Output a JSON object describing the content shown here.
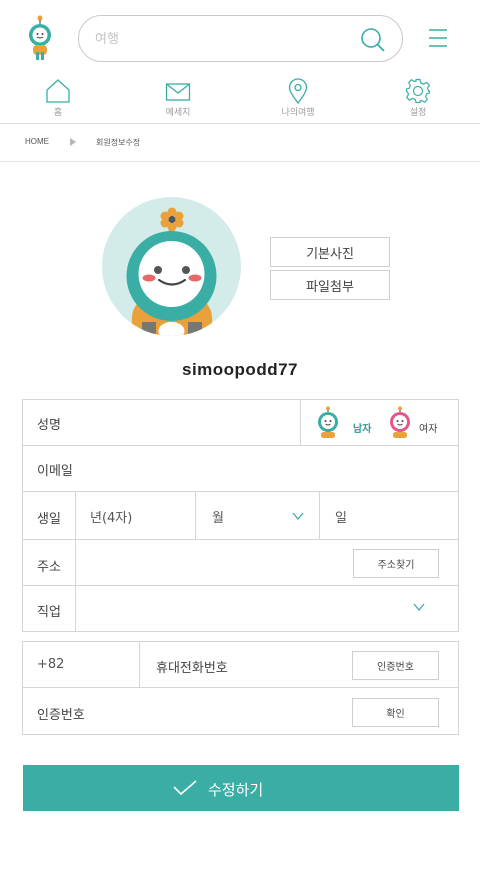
{
  "header": {
    "search_placeholder": "여행"
  },
  "nav": [
    {
      "label": "홈",
      "icon": "home-icon"
    },
    {
      "label": "메세지",
      "icon": "mail-icon"
    },
    {
      "label": "나의여행",
      "icon": "location-pin-icon"
    },
    {
      "label": "설정",
      "icon": "gear-icon"
    }
  ],
  "breadcrumb": {
    "home": "HOME",
    "current": "회원정보수정"
  },
  "profile": {
    "default_photo_label": "기본사진",
    "attach_file_label": "파일첨부",
    "username": "simoopodd77"
  },
  "form": {
    "name_label": "성명",
    "gender_male": "남자",
    "gender_female": "여자",
    "gender_selected": "남자",
    "email_label": "이메일",
    "birth_label": "생일",
    "year_placeholder": "년(4자)",
    "month_placeholder": "월",
    "day_placeholder": "일",
    "address_label": "주소",
    "address_search_button": "주소찾기",
    "job_label": "직업"
  },
  "phone": {
    "country_code": "+82",
    "phone_placeholder": "휴대전화번호",
    "request_code_button": "인증번호",
    "code_label": "인증번호",
    "confirm_button": "확인"
  },
  "submit_label": "수정하기",
  "colors": {
    "accent": "#3aaea5",
    "border": "#d5d5d5",
    "male_text": "#2a9d94",
    "avatar_bg": "#d3ecea",
    "mascot_orange": "#e9a13b",
    "mascot_pink": "#e6548a"
  }
}
